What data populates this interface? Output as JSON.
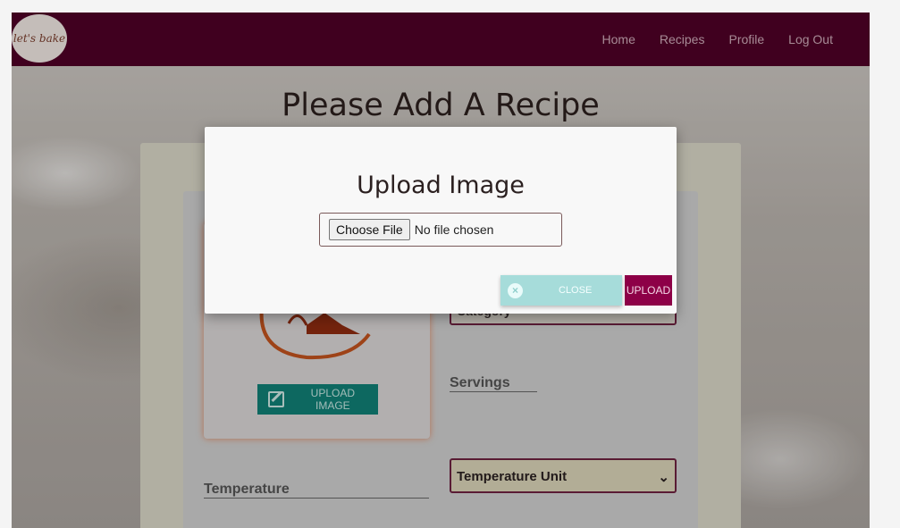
{
  "navbar": {
    "logo_text": "let's bake",
    "links": [
      "Home",
      "Recipes",
      "Profile",
      "Log Out"
    ]
  },
  "page": {
    "title": "Please Add A Recipe"
  },
  "form": {
    "upload_image_label": "UPLOAD IMAGE",
    "category_value": "Category",
    "servings_label": "Servings",
    "temperature_label": "Temperature",
    "temperature_unit_value": "Temperature Unit"
  },
  "modal": {
    "title": "Upload Image",
    "choose_file_label": "Choose File",
    "no_file_text": "No file chosen",
    "close_label": "CLOSE",
    "upload_label": "UPLOAD"
  },
  "colors": {
    "navbar": "#4f0026",
    "teal": "#117f76",
    "accent": "#8d0047"
  }
}
